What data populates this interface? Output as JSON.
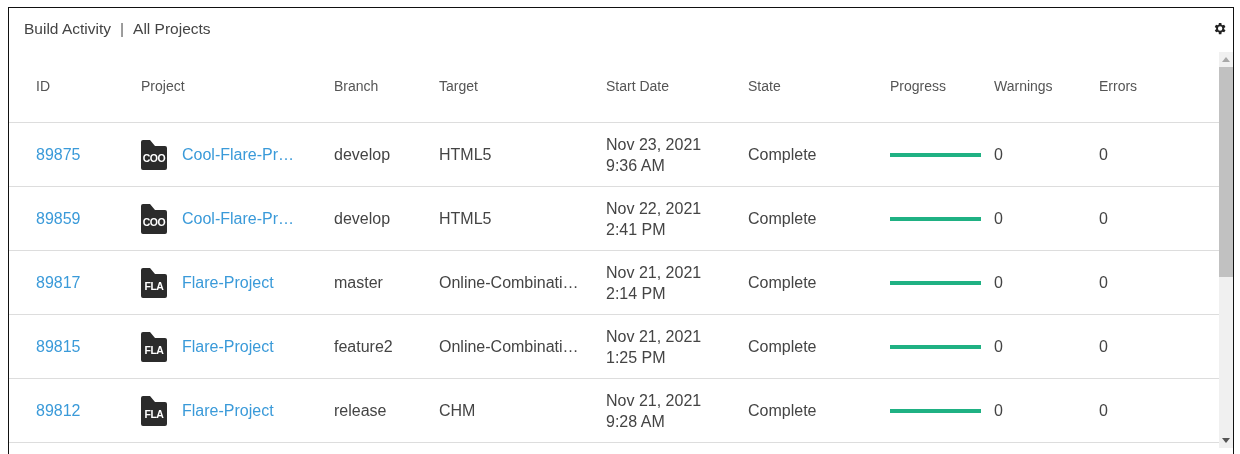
{
  "panel": {
    "title": "Build Activity",
    "separator": "|",
    "scope": "All Projects"
  },
  "table": {
    "columns": [
      "ID",
      "Project",
      "Branch",
      "Target",
      "Start Date",
      "State",
      "Progress",
      "Warnings",
      "Errors"
    ],
    "rows": [
      {
        "id": "89875",
        "project_badge": "COO",
        "project": "Cool-Flare-Pr…",
        "branch": "develop",
        "target": "HTML5",
        "date": "Nov 23, 2021",
        "time": "9:36 AM",
        "state": "Complete",
        "level": 1,
        "warnings": "0",
        "errors": "0"
      },
      {
        "id": "89859",
        "project_badge": "COO",
        "project": "Cool-Flare-Pr…",
        "branch": "develop",
        "target": "HTML5",
        "date": "Nov 22, 2021",
        "time": "2:41 PM",
        "state": "Complete",
        "level": 1,
        "warnings": "0",
        "errors": "0"
      },
      {
        "id": "89817",
        "project_badge": "FLA",
        "project": "Flare-Project",
        "branch": "master",
        "target": "Online-Combinati…",
        "date": "Nov 21, 2021",
        "time": "2:14 PM",
        "state": "Complete",
        "level": 1,
        "warnings": "0",
        "errors": "0"
      },
      {
        "id": "89815",
        "project_badge": "FLA",
        "project": "Flare-Project",
        "branch": "feature2",
        "target": "Online-Combinati…",
        "date": "Nov 21, 2021",
        "time": "1:25 PM",
        "state": "Complete",
        "level": 1,
        "warnings": "0",
        "errors": "0"
      },
      {
        "id": "89812",
        "project_badge": "FLA",
        "project": "Flare-Project",
        "branch": "release",
        "target": "CHM",
        "date": "Nov 21, 2021",
        "time": "9:28 AM",
        "state": "Complete",
        "level": 1,
        "warnings": "0",
        "errors": "0"
      }
    ]
  }
}
